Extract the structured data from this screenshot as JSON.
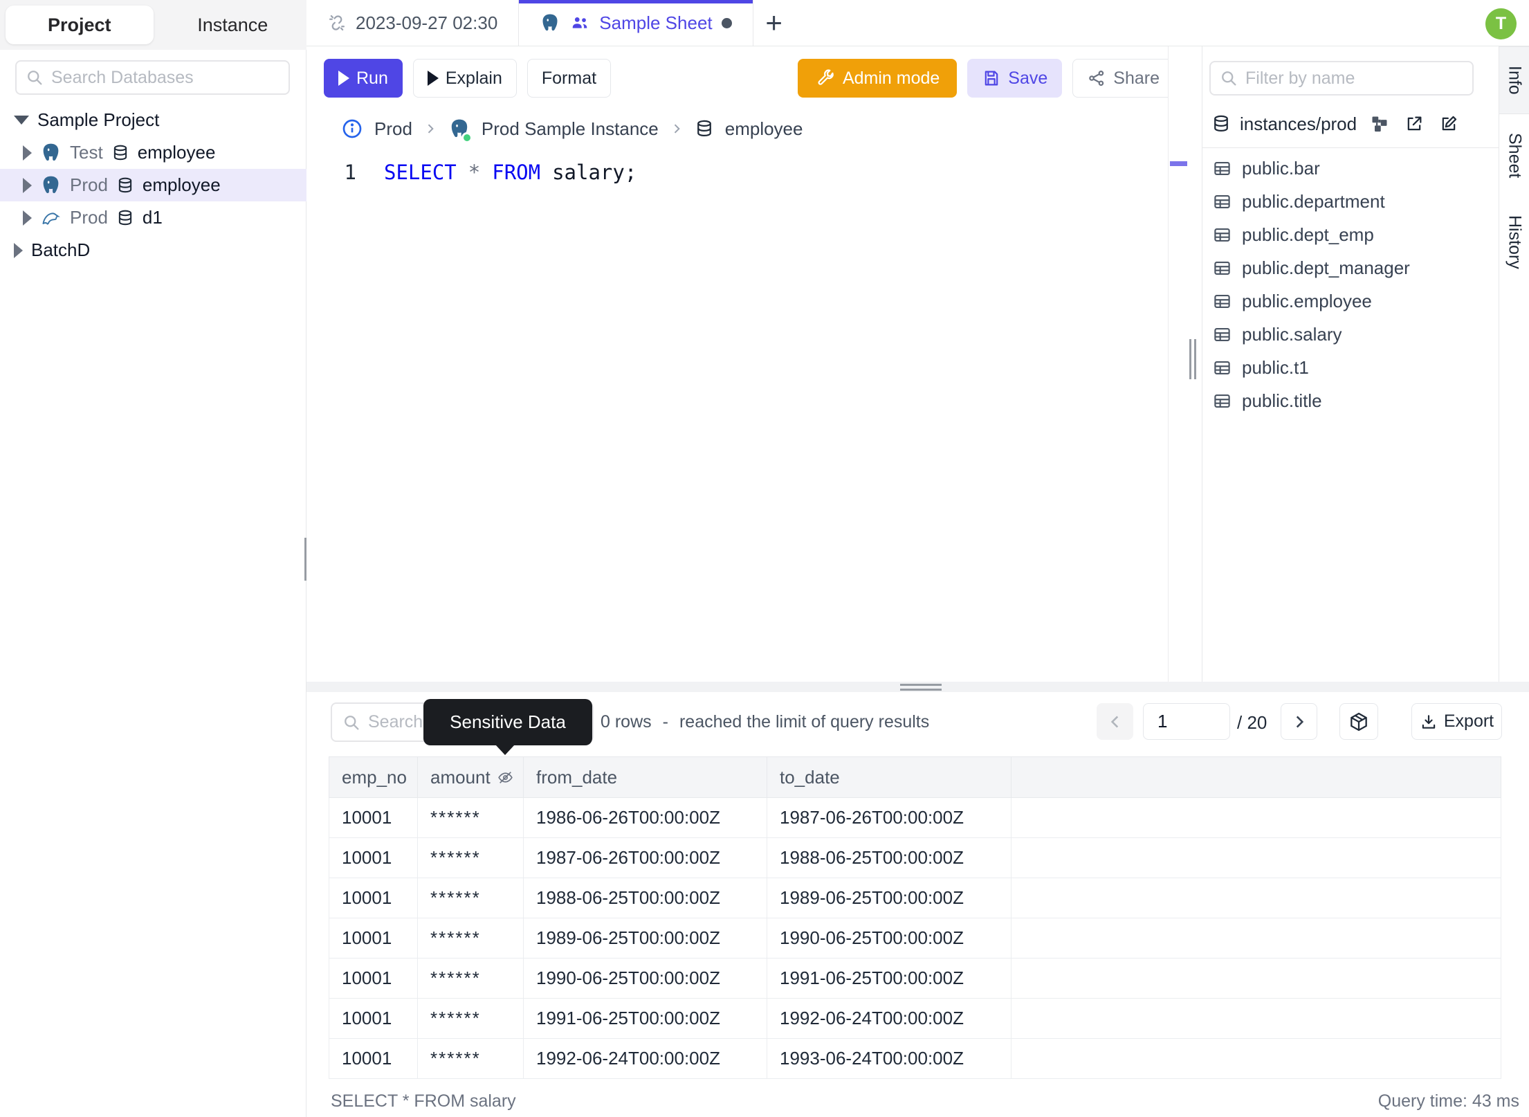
{
  "app": {
    "avatar_initial": "T"
  },
  "sidebar": {
    "tabs": {
      "project": "Project",
      "instance": "Instance"
    },
    "search_placeholder": "Search Databases",
    "tree": {
      "root_project": "Sample Project",
      "databases": [
        {
          "env": "Test",
          "name": "employee",
          "engine": "postgres"
        },
        {
          "env": "Prod",
          "name": "employee",
          "engine": "postgres"
        },
        {
          "env": "Prod",
          "name": "d1",
          "engine": "mysql"
        }
      ],
      "other_project": "BatchD"
    }
  },
  "sheet_tabs": {
    "tab1": "2023-09-27 02:30",
    "tab2": "Sample Sheet",
    "add": "+"
  },
  "toolbar": {
    "run": "Run",
    "explain": "Explain",
    "format": "Format",
    "admin_mode": "Admin mode",
    "save": "Save",
    "share": "Share"
  },
  "breadcrumb": {
    "environment": "Prod",
    "instance": "Prod Sample Instance",
    "database": "employee"
  },
  "editor": {
    "line_number": "1",
    "sql": {
      "kw1": "SELECT",
      "star": "*",
      "kw2": "FROM",
      "rest": "salary;"
    }
  },
  "schema_panel": {
    "filter_placeholder": "Filter by name",
    "source": "instances/prod",
    "tables": [
      "public.bar",
      "public.department",
      "public.dept_emp",
      "public.dept_manager",
      "public.employee",
      "public.salary",
      "public.t1",
      "public.title"
    ]
  },
  "side_tabs": [
    "Info",
    "Sheet",
    "History"
  ],
  "results": {
    "search_placeholder": "Search",
    "tooltip": "Sensitive Data",
    "summary": {
      "rows": "0 rows",
      "dash": "-",
      "note": "reached the limit of query results"
    },
    "pagination": {
      "page": "1",
      "total": "/ 20"
    },
    "export_label": "Export",
    "table": {
      "headers": [
        "emp_no",
        "amount",
        "from_date",
        "to_date"
      ],
      "rows": [
        [
          "10001",
          "******",
          "1986-06-26T00:00:00Z",
          "1987-06-26T00:00:00Z"
        ],
        [
          "10001",
          "******",
          "1987-06-26T00:00:00Z",
          "1988-06-25T00:00:00Z"
        ],
        [
          "10001",
          "******",
          "1988-06-25T00:00:00Z",
          "1989-06-25T00:00:00Z"
        ],
        [
          "10001",
          "******",
          "1989-06-25T00:00:00Z",
          "1990-06-25T00:00:00Z"
        ],
        [
          "10001",
          "******",
          "1990-06-25T00:00:00Z",
          "1991-06-25T00:00:00Z"
        ],
        [
          "10001",
          "******",
          "1991-06-25T00:00:00Z",
          "1992-06-24T00:00:00Z"
        ],
        [
          "10001",
          "******",
          "1992-06-24T00:00:00Z",
          "1993-06-24T00:00:00Z"
        ]
      ]
    },
    "status": {
      "query": "SELECT * FROM salary",
      "time": "Query time: 43 ms"
    }
  },
  "colors": {
    "accent": "#4f46e5",
    "admin_orange": "#f0a009",
    "avatar_green": "#7bc143",
    "keyword_blue": "#0909f2",
    "tooltip_bg": "#1b1d21",
    "selected_row_bg": "#eceafb"
  }
}
